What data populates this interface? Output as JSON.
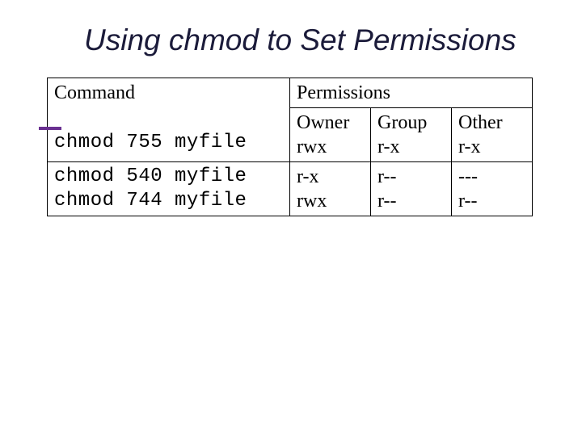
{
  "title": "Using chmod to Set Permissions",
  "headers": {
    "command": "Command",
    "permissions": "Permissions",
    "owner": "Owner",
    "group": "Group",
    "other": "Other"
  },
  "rows": [
    {
      "command": "chmod 755 myfile",
      "owner": "rwx",
      "group": "r-x",
      "other": "r-x"
    },
    {
      "command": "chmod 540 myfile",
      "owner": "r-x",
      "group": "r--",
      "other": "---"
    },
    {
      "command": "chmod 744 myfile",
      "owner": "rwx",
      "group": "r--",
      "other": "r--"
    }
  ]
}
